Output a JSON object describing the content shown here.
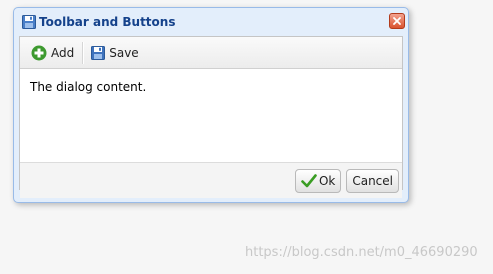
{
  "dialog": {
    "title": "Toolbar and Buttons",
    "title_icon": "save-disk-icon",
    "close_icon": "close-x-icon"
  },
  "toolbar": {
    "add_label": "Add",
    "add_icon": "green-plus-icon",
    "save_label": "Save",
    "save_icon": "blue-floppy-disk-icon"
  },
  "content": {
    "text": "The dialog content."
  },
  "footer": {
    "ok_label": "Ok",
    "ok_icon": "green-checkmark-icon",
    "cancel_label": "Cancel"
  },
  "watermark": {
    "text": "https://blog.csdn.net/m0_46690290"
  },
  "colors": {
    "title_text": "#15428b",
    "dialog_frame": "#e3eefb",
    "dialog_border": "#99bbe8",
    "close_button": "#d9532f"
  }
}
